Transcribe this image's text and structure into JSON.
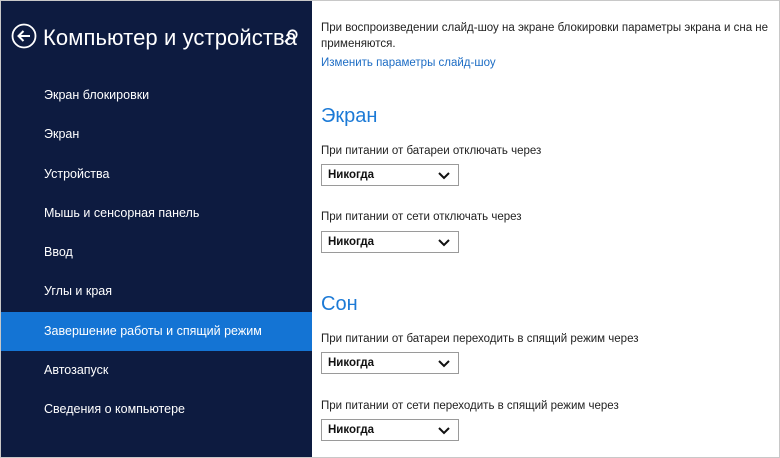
{
  "header": {
    "title": "Компьютер и устройства",
    "back_icon": "back-arrow-circle-icon",
    "search_icon": "search-icon"
  },
  "sidebar": {
    "selected_color": "#1474d4",
    "background": "#0d1b40",
    "items": [
      {
        "label": "Экран блокировки"
      },
      {
        "label": "Экран"
      },
      {
        "label": "Устройства"
      },
      {
        "label": "Мышь и сенсорная панель"
      },
      {
        "label": "Ввод"
      },
      {
        "label": "Углы и края"
      },
      {
        "label": "Завершение работы и спящий режим",
        "selected": true
      },
      {
        "label": "Автозапуск"
      },
      {
        "label": "Сведения о компьютере"
      }
    ]
  },
  "main": {
    "note": "При воспроизведении слайд-шоу на экране блокировки параметры экрана и сна не применяются.",
    "link": "Изменить параметры слайд-шоу",
    "screen": {
      "title": "Экран",
      "battery_label": "При питании от батареи отключать через",
      "battery_value": "Никогда",
      "ac_label": "При питании от сети отключать через",
      "ac_value": "Никогда"
    },
    "sleep": {
      "title": "Сон",
      "battery_label": "При питании от батареи переходить в спящий режим через",
      "battery_value": "Никогда",
      "ac_label": "При питании от сети переходить в спящий режим через",
      "ac_value": "Никогда"
    }
  }
}
